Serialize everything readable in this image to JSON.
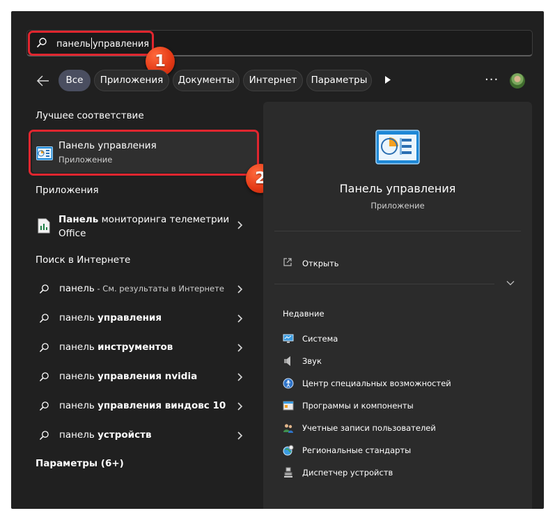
{
  "search": {
    "text_before_caret": "панель",
    "text_after_caret": "управления"
  },
  "badges": {
    "one": "1",
    "two": "2"
  },
  "filters": [
    {
      "label": "Все",
      "active": true
    },
    {
      "label": "Приложения",
      "active": false
    },
    {
      "label": "Документы",
      "active": false
    },
    {
      "label": "Интернет",
      "active": false
    },
    {
      "label": "Параметры",
      "active": false
    }
  ],
  "more_icon": "ellipsis-icon",
  "sections": {
    "best_match_title": "Лучшее соответствие",
    "apps_title": "Приложения",
    "web_title": "Поиск в Интернете",
    "settings_title": "Параметры (6+)"
  },
  "best_match": {
    "name": "Панель управления",
    "type": "Приложение",
    "icon": "control-panel-icon"
  },
  "apps": [
    {
      "name_bold": "Панель",
      "name_rest": " мониторинга телеметрии",
      "name_line2": "Office",
      "icon": "document-chart-icon"
    }
  ],
  "web_results": [
    {
      "normal": "панель",
      "bold": "",
      "suffix": " - См. результаты в Интернете"
    },
    {
      "normal": "панель ",
      "bold": "управления",
      "suffix": ""
    },
    {
      "normal": "панель ",
      "bold": "инструментов",
      "suffix": ""
    },
    {
      "normal": "панель ",
      "bold": "управления nvidia",
      "suffix": ""
    },
    {
      "normal": "панель ",
      "bold": "управления виндовс 10",
      "suffix": ""
    },
    {
      "normal": "панель ",
      "bold": "устройств",
      "suffix": ""
    }
  ],
  "detail": {
    "title": "Панель управления",
    "subtitle": "Приложение",
    "open_label": "Открыть",
    "recent_title": "Недавние",
    "recent": [
      {
        "label": "Система",
        "icon": "system-monitor-icon"
      },
      {
        "label": "Звук",
        "icon": "speaker-icon"
      },
      {
        "label": "Центр специальных возможностей",
        "icon": "accessibility-icon"
      },
      {
        "label": "Программы и компоненты",
        "icon": "programs-icon"
      },
      {
        "label": "Учетные записи пользователей",
        "icon": "users-icon"
      },
      {
        "label": "Региональные стандарты",
        "icon": "globe-clock-icon"
      },
      {
        "label": "Диспетчер устройств",
        "icon": "device-manager-icon"
      }
    ]
  },
  "colors": {
    "background": "#202020",
    "detail_panel": "#2b2b2b",
    "highlight": "#e0262f",
    "badge": "#e53b17",
    "active_chip": "#4a4e60"
  }
}
